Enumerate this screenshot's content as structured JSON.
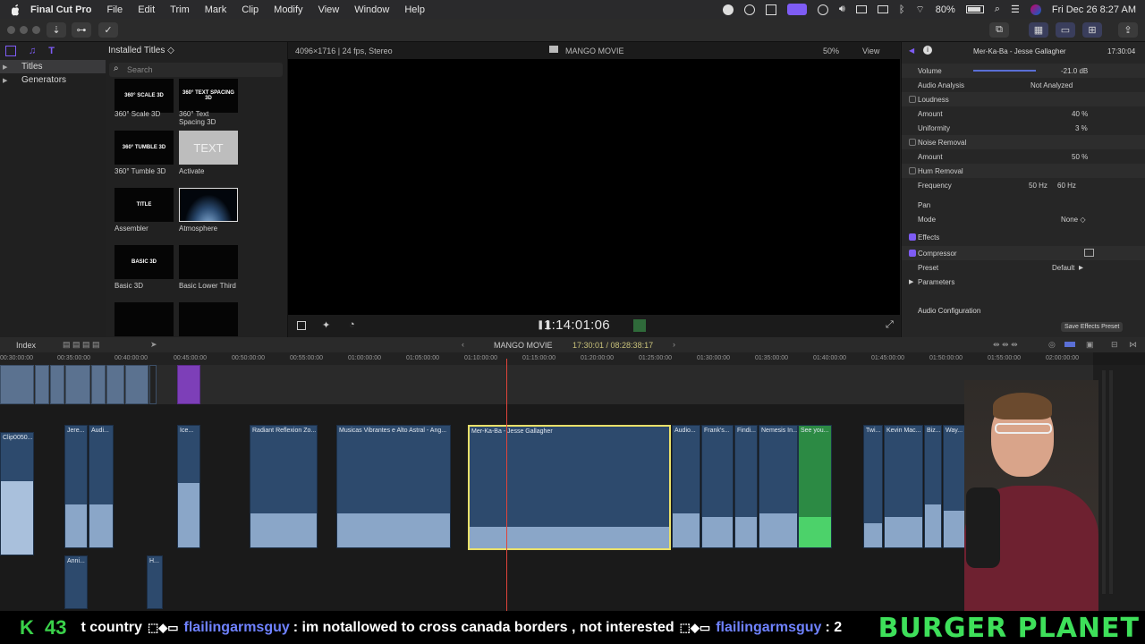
{
  "menubar": {
    "app": "Final Cut Pro",
    "items": [
      "File",
      "Edit",
      "Trim",
      "Mark",
      "Clip",
      "Modify",
      "View",
      "Window",
      "Help"
    ],
    "battery": "80%",
    "datetime": "Fri Dec 26  8:27 AM"
  },
  "browser": {
    "sidebar": [
      "Titles",
      "Generators"
    ],
    "header": "Installed Titles ◇",
    "search_placeholder": "Search",
    "items": [
      {
        "thumb": "360° SCALE 3D",
        "label": "360° Scale 3D"
      },
      {
        "thumb": "360° TEXT SPACING 3D",
        "label": "360° Text Spacing 3D"
      },
      {
        "thumb": "360° TUMBLE 3D",
        "label": "360° Tumble 3D"
      },
      {
        "thumb": "TEXT",
        "label": "Activate"
      },
      {
        "thumb": "TITLE",
        "label": "Assembler"
      },
      {
        "thumb": "",
        "label": "Atmosphere"
      },
      {
        "thumb": "BASIC 3D",
        "label": "Basic 3D"
      },
      {
        "thumb": "",
        "label": "Basic Lower Third"
      },
      {
        "thumb": "",
        "label": ""
      },
      {
        "thumb": "",
        "label": ""
      }
    ]
  },
  "viewer": {
    "format": "4096×1716 | 24 fps, Stereo",
    "title": "MANGO MOVIE",
    "zoom": "50%",
    "view": "View",
    "timecode": "1:14:01:06"
  },
  "inspector": {
    "clip": "Mer-Ka-Ba - Jesse Gallagher",
    "duration": "17:30:04",
    "rows": [
      {
        "lbl": "Volume",
        "val": "-21.0  dB",
        "hdr": false
      },
      {
        "lbl": "Audio Analysis",
        "val": "Not Analyzed",
        "hdr": false
      },
      {
        "lbl": "Loudness",
        "val": "",
        "hdr": true,
        "chk": "off"
      },
      {
        "lbl": "Amount",
        "val": "40  %",
        "hdr": false
      },
      {
        "lbl": "Uniformity",
        "val": "3  %",
        "hdr": false
      },
      {
        "lbl": "Noise Removal",
        "val": "",
        "hdr": true,
        "chk": "off"
      },
      {
        "lbl": "Amount",
        "val": "50  %",
        "hdr": false
      },
      {
        "lbl": "Hum Removal",
        "val": "",
        "hdr": true,
        "chk": "off"
      },
      {
        "lbl": "Frequency",
        "val": "50 Hz     60 Hz",
        "hdr": false
      },
      {
        "lbl": "Pan",
        "val": "",
        "hdr": false
      },
      {
        "lbl": "Mode",
        "val": "None ◇",
        "hdr": false
      },
      {
        "lbl": "Effects",
        "val": "",
        "hdr": false,
        "chk": "on"
      },
      {
        "lbl": "Compressor",
        "val": "",
        "hdr": true,
        "chk": "on"
      },
      {
        "lbl": "Preset",
        "val": "Default",
        "hdr": false
      },
      {
        "lbl": "Parameters",
        "val": "",
        "hdr": false
      }
    ],
    "audio_config": "Audio Configuration",
    "save_preset": "Save Effects Preset"
  },
  "timeline": {
    "index": "Index",
    "project": "MANGO MOVIE",
    "position": "17:30:01 / 08:28:38:17",
    "ruler": [
      "00:30:00:00",
      "00:35:00:00",
      "00:40:00:00",
      "00:45:00:00",
      "00:50:00:00",
      "00:55:00:00",
      "01:00:00:00",
      "01:05:00:00",
      "01:10:00:00",
      "01:15:00:00",
      "01:20:00:00",
      "01:25:00:00",
      "01:30:00:00",
      "01:35:00:00",
      "01:40:00:00",
      "01:45:00:00",
      "01:50:00:00",
      "01:55:00:00",
      "02:00:00:00"
    ],
    "clips": [
      "Clip0050...",
      "Jere...",
      "Audi...",
      "Ice...",
      "Radiant Reflexion Zo...",
      "Musicas Vibrantes e Alto Astral - Ang...",
      "Mer-Ka-Ba - Jesse Gallagher",
      "Audio...",
      "Frank's...",
      "Findi...",
      "Nemesis In...",
      "See you...",
      "Twi...",
      "Kevin Mac...",
      "Biz...",
      "Way...",
      "Anni...",
      "H..."
    ]
  },
  "chat": {
    "count": "43",
    "msg1": "t country",
    "user1": "flailingarmsguy",
    "msg2": ": im notallowed to cross canada borders , not interested",
    "user2": "flailingarmsguy",
    "msg3": ": 2",
    "brand": "BURGER PLANET"
  }
}
